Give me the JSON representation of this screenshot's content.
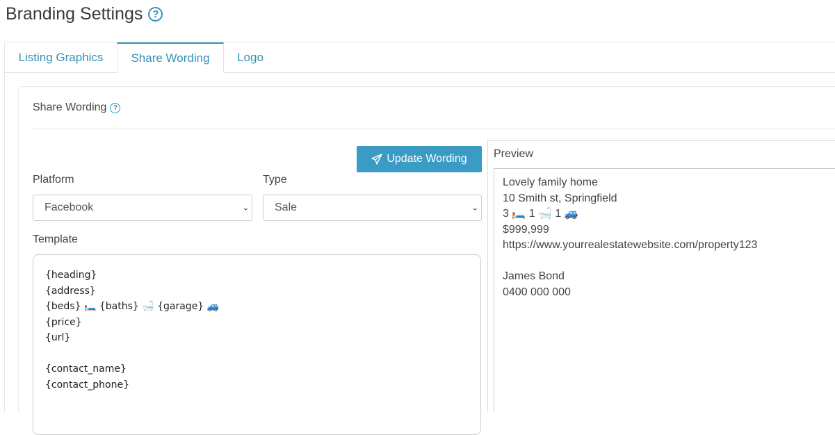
{
  "page": {
    "title": "Branding Settings",
    "help_icon": "?"
  },
  "tabs": [
    {
      "label": "Listing Graphics",
      "active": false
    },
    {
      "label": "Share Wording",
      "active": true
    },
    {
      "label": "Logo",
      "active": false
    }
  ],
  "card": {
    "title": "Share Wording",
    "help_icon": "?"
  },
  "actions": {
    "update_label": "Update Wording",
    "update_icon": "paper-plane-icon"
  },
  "platform": {
    "label": "Platform",
    "value": "Facebook"
  },
  "type": {
    "label": "Type",
    "value": "Sale"
  },
  "template": {
    "label": "Template",
    "lines": [
      "{heading}",
      "{address}",
      "{beds} 🛏️ {baths} 🛁 {garage} 🚙",
      "{price}",
      "{url}",
      "",
      "{contact_name}",
      "{contact_phone}"
    ]
  },
  "preview": {
    "label": "Preview",
    "lines": [
      "Lovely family home",
      "10 Smith st, Springfield",
      "3 🛏️ 1 🛁 1 🚙",
      "$999,999",
      "https://www.yourrealestatewebsite.com/property123",
      "",
      "James Bond",
      "0400 000 000"
    ]
  },
  "colors": {
    "accent": "#3391b8",
    "button": "#3a9bc4"
  }
}
